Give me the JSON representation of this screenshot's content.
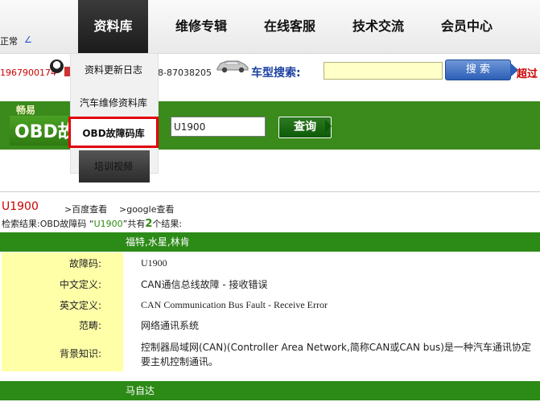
{
  "nav": {
    "items": [
      "资料库",
      "维修专辑",
      "在线客服",
      "技术交流",
      "会员中心"
    ],
    "active_index": 0,
    "status_text": "正常",
    "status_link": "∠"
  },
  "dropdown": {
    "items": [
      "资料更新日志",
      "汽车维修资料库",
      "OBD故障码库",
      "培训视频"
    ],
    "highlighted_index": 2
  },
  "infobar": {
    "phone": "1967900174",
    "fax_partial": "8-87038205",
    "model_search_label": "车型搜索:",
    "model_search_value": "",
    "search_button": "搜 索",
    "over_label": "超过"
  },
  "banner": {
    "brand_small": "畅易",
    "brand_big": "OBD故",
    "code_value": "U1900",
    "query_button": "查询"
  },
  "result": {
    "code_title": "U1900",
    "baidu_link": ">百度查看",
    "google_link": ">google查看",
    "summary_prefix": "检索结果:OBD故障码 “",
    "summary_code": "U1900",
    "summary_middle": "”共有",
    "summary_count": "2",
    "summary_suffix": "个结果:"
  },
  "groups": [
    {
      "header": "福特,水星,林肯",
      "rows": [
        {
          "label": "故障码:",
          "value": "U1900"
        },
        {
          "label": "中文定义:",
          "value": "CAN通信总线故障 - 接收错误"
        },
        {
          "label": "英文定义:",
          "value": "CAN Communication Bus Fault - Receive Error"
        },
        {
          "label": "范畴:",
          "value": "网络通讯系统"
        },
        {
          "label": "背景知识:",
          "value": "控制器局域网(CAN)(Controller Area Network,简称CAN或CAN bus)是一种汽车通讯协定要主机控制通讯。"
        }
      ]
    },
    {
      "header": "马自达",
      "rows": []
    }
  ],
  "colors": {
    "green": "#2c8a17",
    "label_bg": "#ffffa8",
    "red": "#cc0000",
    "highlight_border": "#e0000a"
  }
}
